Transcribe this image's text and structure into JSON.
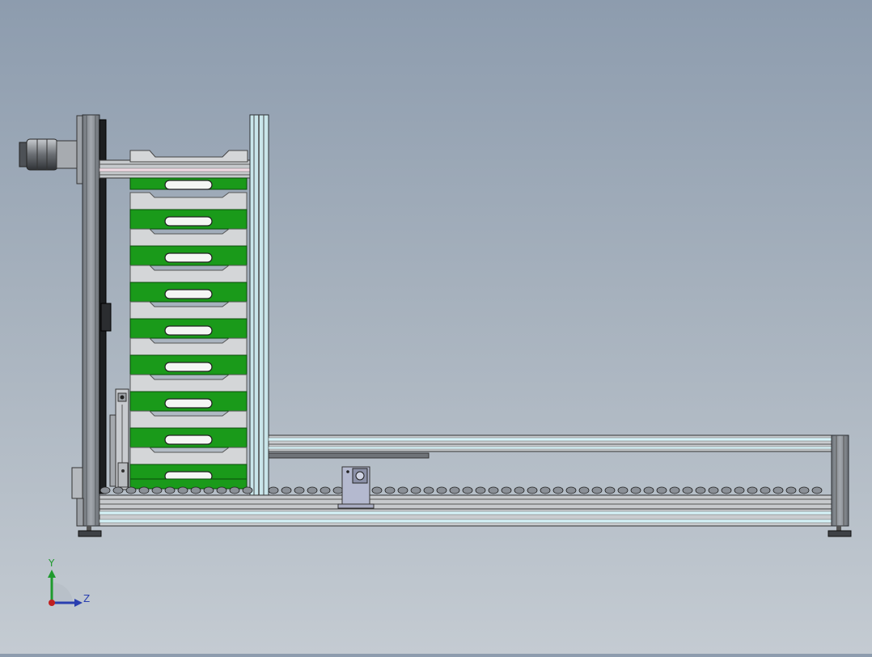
{
  "viewport": {
    "background_top": "#8d9cae",
    "background_bottom": "#c4cbd2"
  },
  "model": {
    "tray_count": 9,
    "tray_color": "#1a9a1a",
    "tray_rim_color": "#d4d6d8",
    "frame_color": "#8f949a",
    "rail_highlight_color": "#d6f3f8",
    "roller_color": "#8b9097"
  },
  "triad": {
    "y_label": "Y",
    "z_label": "Z",
    "y_color": "#1f9a2e",
    "z_color": "#2a3fb0",
    "x_color": "#c02020"
  }
}
